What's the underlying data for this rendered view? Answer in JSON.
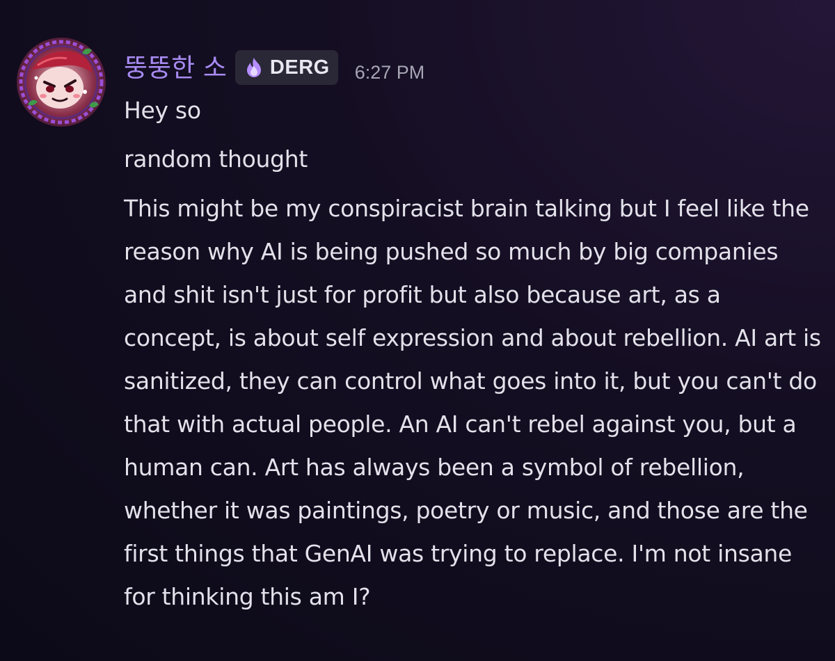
{
  "message": {
    "author": {
      "username": "뚱뚱한 소",
      "avatar_icon": "avatar-cartoon-character-icon",
      "tag": {
        "icon": "purple-flame-icon",
        "label": "DERG"
      }
    },
    "timestamp": "6:27 PM",
    "lines": [
      "Hey so",
      "random thought",
      "This might be my conspiracist brain talking but I feel like the reason why AI is being pushed so much by big companies and shit isn't just for profit but also because art, as a concept, is about self expression and about rebellion. AI art is sanitized, they can control what goes into it, but you can't do that with actual people. An AI can't rebel against you, but a human can. Art has always been a symbol of rebellion, whether it was paintings, poetry or music, and those are the first things that GenAI was trying to replace. I'm not insane for thinking this am I?"
    ]
  },
  "colors": {
    "background": "#140e22",
    "username": "#a88bf2",
    "tag_background": "#2a2736",
    "text": "#e3e1ea",
    "timestamp": "#a8a6b5"
  }
}
